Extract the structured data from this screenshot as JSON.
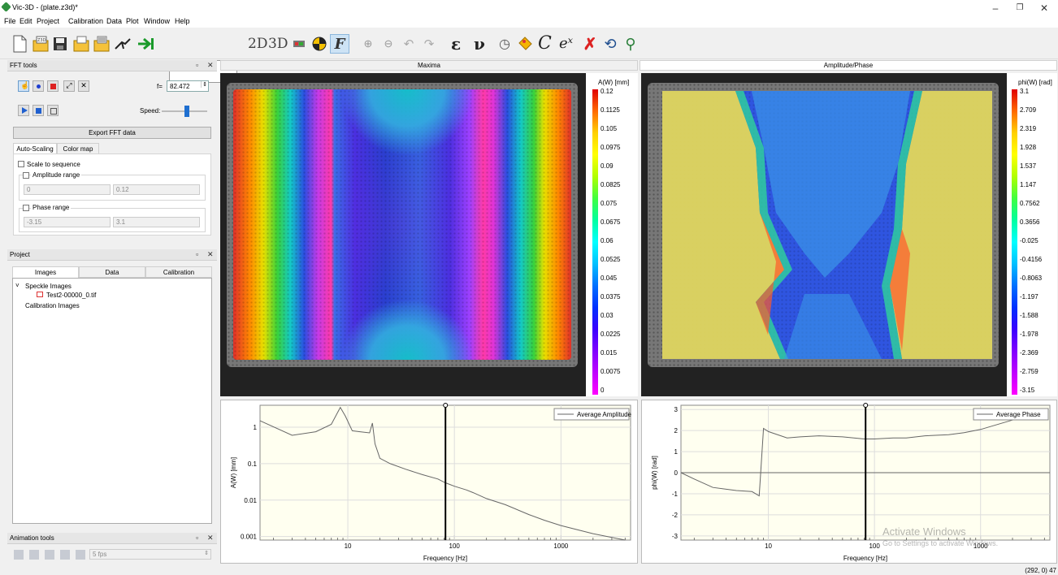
{
  "app": {
    "title": "Vic-3D - (plate.z3d)*"
  },
  "window_controls": {
    "minimize": "–",
    "restore": "❐",
    "close": "✕"
  },
  "menu": [
    "File",
    "Edit",
    "Project",
    "Calibration",
    "Data",
    "Plot",
    "Window",
    "Help"
  ],
  "toolbar": {
    "btn_2d": "2D",
    "btn_3d": "3D",
    "eps": "ε",
    "nu": "ν",
    "c": "C",
    "ex": "eˣ"
  },
  "fft_tools": {
    "title": "FFT tools",
    "freq_label": "f=",
    "freq_value": "82.472",
    "speed_label": "Speed:",
    "export_label": "Export FFT data",
    "tabs": [
      "Auto-Scaling",
      "Color map"
    ],
    "scale_to_sequence": "Scale to sequence",
    "amplitude_range": "Amplitude range",
    "amp_min": "0",
    "amp_max": "0.12",
    "phase_range": "Phase range",
    "phase_min": "-3.15",
    "phase_max": "3.1",
    "speed_level": 0.55
  },
  "project": {
    "title": "Project",
    "tabs": [
      "Images",
      "Data",
      "Calibration"
    ],
    "tree": {
      "speckle": "Speckle Images",
      "file": "Test2-00000_0.tif",
      "calibration": "Calibration Images"
    }
  },
  "animation_tools": {
    "title": "Animation tools",
    "fps": "5 fps"
  },
  "views": {
    "left_title": "Maxima",
    "right_title": "Amplitude/Phase"
  },
  "colorbar_left": {
    "title": "A(W) [mm]",
    "ticks": [
      "0.12",
      "0.1125",
      "0.105",
      "0.0975",
      "0.09",
      "0.0825",
      "0.075",
      "0.0675",
      "0.06",
      "0.0525",
      "0.045",
      "0.0375",
      "0.03",
      "0.0225",
      "0.015",
      "0.0075",
      "0"
    ]
  },
  "colorbar_right": {
    "title": "phi(W) [rad]",
    "ticks": [
      "3.1",
      "2.709",
      "2.319",
      "1.928",
      "1.537",
      "1.147",
      "0.7562",
      "0.3656",
      "-0.025",
      "-0.4156",
      "-0.8063",
      "-1.197",
      "-1.588",
      "-1.978",
      "-2.369",
      "-2.759",
      "-3.15"
    ]
  },
  "chart_data": [
    {
      "type": "line",
      "title": "",
      "xlabel": "Frequency [Hz]",
      "ylabel": "A(W) [mm]",
      "xscale": "log",
      "yscale": "log",
      "xlim": [
        1.5,
        4500
      ],
      "ylim": [
        0.0008,
        4
      ],
      "xticks": [
        "10",
        "100",
        "1000"
      ],
      "yticks": [
        "1",
        "0.1",
        "0.01",
        "0.001"
      ],
      "grid": true,
      "legend": "top-right",
      "cursor_x": 82.472,
      "series": [
        {
          "name": "Average Amplitude",
          "x": [
            1.5,
            3,
            5,
            7,
            8.5,
            9.5,
            11,
            13,
            16,
            17,
            18,
            20,
            25,
            35,
            50,
            70,
            82,
            90,
            100,
            130,
            150,
            200,
            300,
            500,
            700,
            1000,
            2000,
            4000
          ],
          "y": [
            1.5,
            0.6,
            0.75,
            1.2,
            3.5,
            2.0,
            0.8,
            0.75,
            0.7,
            1.3,
            0.35,
            0.14,
            0.1,
            0.07,
            0.05,
            0.038,
            0.03,
            0.027,
            0.024,
            0.019,
            0.016,
            0.011,
            0.0075,
            0.004,
            0.0028,
            0.002,
            0.0012,
            0.0008
          ]
        }
      ]
    },
    {
      "type": "line",
      "title": "",
      "xlabel": "Frequency [Hz]",
      "ylabel": "phi(W) [rad]",
      "xscale": "log",
      "xlim": [
        1.5,
        4500
      ],
      "ylim": [
        -3.2,
        3.2
      ],
      "xticks": [
        "10",
        "100",
        "1000"
      ],
      "yticks": [
        "3",
        "2",
        "1",
        "0",
        "-1",
        "-2",
        "-3"
      ],
      "grid": true,
      "legend": "top-right",
      "cursor_x": 82.472,
      "series": [
        {
          "name": "Average Phase",
          "x": [
            1.5,
            2,
            3,
            5,
            7,
            8.2,
            9,
            10,
            15,
            20,
            30,
            50,
            80,
            100,
            150,
            200,
            300,
            500,
            700,
            1000,
            2000,
            4000
          ],
          "y": [
            0,
            -0.3,
            -0.7,
            -0.85,
            -0.9,
            -1.1,
            2.1,
            1.95,
            1.65,
            1.7,
            1.75,
            1.7,
            1.6,
            1.6,
            1.65,
            1.65,
            1.75,
            1.8,
            1.9,
            2.05,
            2.5,
            3.0
          ]
        }
      ]
    }
  ],
  "watermark": {
    "line1": "Activate Windows",
    "line2": "Go to Settings to activate Windows."
  },
  "status": {
    "coords": "(292, 0) 47"
  }
}
